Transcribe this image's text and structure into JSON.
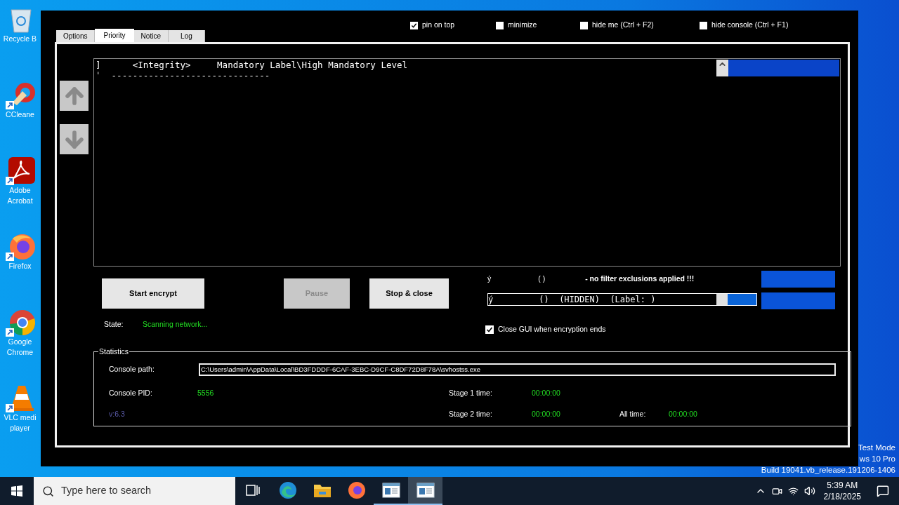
{
  "desktop": {
    "icons": [
      {
        "kind": "recycle-bin",
        "lines": [
          "Recycle B"
        ]
      },
      {
        "kind": "ccleaner",
        "lines": [
          "CCleane"
        ]
      },
      {
        "kind": "acrobat",
        "lines": [
          "Adobe",
          "Acrobat"
        ]
      },
      {
        "kind": "firefox",
        "lines": [
          "Firefox"
        ]
      },
      {
        "kind": "chrome",
        "lines": [
          "Google",
          "Chrome"
        ]
      },
      {
        "kind": "vlc",
        "lines": [
          "VLC medi",
          "player"
        ]
      }
    ],
    "watermark": [
      "Test Mode",
      "ws 10 Pro",
      "Build 19041.vb_release.191206-1406"
    ]
  },
  "window": {
    "tabs": [
      {
        "label": "Options",
        "selected": false
      },
      {
        "label": "Priority",
        "selected": true
      },
      {
        "label": "Notice",
        "selected": false
      },
      {
        "label": "Log",
        "selected": false
      }
    ],
    "options": [
      {
        "label": "pin on top",
        "checked": true
      },
      {
        "label": "minimize",
        "checked": false
      },
      {
        "label": "hide me (Ctrl + F2)",
        "checked": false
      },
      {
        "label": "hide console (Ctrl + F1)",
        "checked": false
      }
    ],
    "console": {
      "lines": [
        "]      <Integrity>     Mandatory Label\\High Mandatory Level",
        "ˈ  ------------------------------"
      ]
    },
    "buttons": [
      {
        "label": "Start encrypt",
        "disabled": false
      },
      {
        "label": "Pause",
        "disabled": true
      },
      {
        "label": "Stop & close",
        "disabled": false
      }
    ],
    "state": {
      "label": "State:",
      "value": "Scanning network..."
    },
    "filter": {
      "texts": [
        "ý",
        "( )",
        "- no filter exclusions applied !!!"
      ],
      "field_value": "ý         ()  (HIDDEN)  (Label: )"
    },
    "close_gui": {
      "label": "Close GUI when encryption ends",
      "checked": true
    },
    "statistics": {
      "title": "Statistics",
      "console_path": {
        "label": "Console path:",
        "value": "C:\\Users\\admin\\AppData\\Local\\BD3FDDDF-6CAF-3EBC-D9CF-C8DF72D8F78A\\svhostss.exe"
      },
      "console_pid": {
        "label": "Console PID:",
        "value": "5556"
      },
      "version": "v:6.3",
      "stage_1_time": {
        "label": "Stage 1 time:",
        "value": "00:00:00"
      },
      "stage_2_time": {
        "label": "Stage 2 time:",
        "value": "00:00:00"
      },
      "all_time": {
        "label": "All time:",
        "value": "00:00:00"
      }
    }
  },
  "taskbar": {
    "search_placeholder": "Type here to search",
    "apps": [
      {
        "kind": "task-view",
        "running": false,
        "selected": false
      },
      {
        "kind": "edge",
        "running": false,
        "selected": false
      },
      {
        "kind": "explorer",
        "running": false,
        "selected": false
      },
      {
        "kind": "firefox",
        "running": false,
        "selected": false
      },
      {
        "kind": "app-window",
        "running": true,
        "selected": false
      },
      {
        "kind": "app-window",
        "running": true,
        "selected": true
      }
    ],
    "time": "5:39 AM",
    "date": "2/18/2025"
  }
}
